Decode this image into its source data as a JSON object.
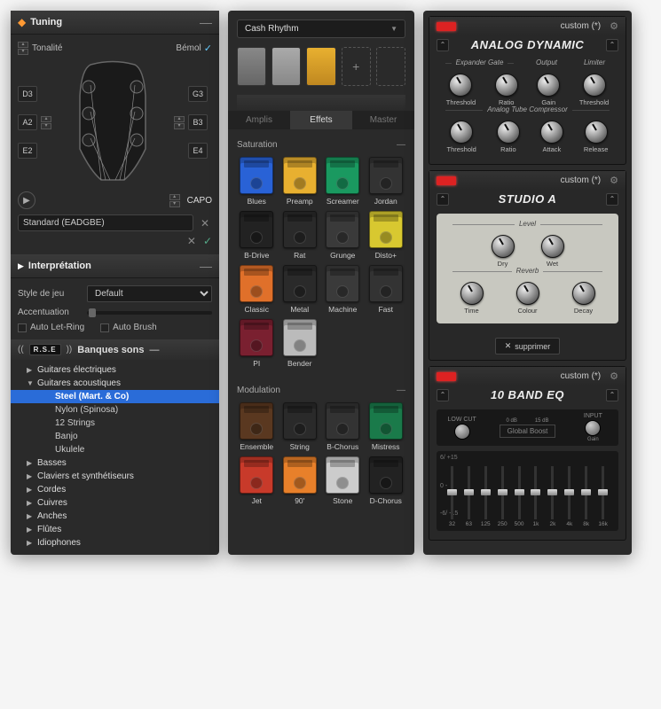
{
  "tuning": {
    "title": "Tuning",
    "tonalite": "Tonalité",
    "bemol": "Bémol",
    "pegs_left": [
      "D3",
      "A2",
      "E2"
    ],
    "pegs_right": [
      "G3",
      "B3",
      "E4"
    ],
    "capo": "CAPO",
    "preset": "Standard (EADGBE)"
  },
  "interp": {
    "title": "Interprétation",
    "style_label": "Style de jeu",
    "style_value": "Default",
    "accent_label": "Accentuation",
    "auto_letring": "Auto Let-Ring",
    "auto_brush": "Auto Brush"
  },
  "banks": {
    "rse": "R.S.E",
    "title": "Banques sons",
    "items": [
      {
        "label": "Guitares électriques",
        "exp": "▶"
      },
      {
        "label": "Guitares acoustiques",
        "exp": "▼"
      },
      {
        "label": "Steel (Mart. & Co)",
        "sel": true,
        "sub": true
      },
      {
        "label": "Nylon (Spinosa)",
        "sub": true
      },
      {
        "label": "12 Strings",
        "sub": true
      },
      {
        "label": "Banjo",
        "sub": true
      },
      {
        "label": "Ukulele",
        "sub": true
      },
      {
        "label": "Basses",
        "exp": "▶"
      },
      {
        "label": "Claviers et synthétiseurs",
        "exp": "▶"
      },
      {
        "label": "Cordes",
        "exp": "▶"
      },
      {
        "label": "Cuivres",
        "exp": "▶"
      },
      {
        "label": "Anches",
        "exp": "▶"
      },
      {
        "label": "Flûtes",
        "exp": "▶"
      },
      {
        "label": "Idiophones",
        "exp": "▶"
      }
    ]
  },
  "fx": {
    "preset": "Cash Rhythm",
    "tabs": [
      "Amplis",
      "Effets",
      "Master"
    ],
    "sections": [
      {
        "title": "Saturation",
        "pedals": [
          {
            "label": "Blues",
            "color": "#2962d6"
          },
          {
            "label": "Preamp",
            "color": "#e8b030"
          },
          {
            "label": "Screamer",
            "color": "#1a9960"
          },
          {
            "label": "Jordan",
            "color": "#333"
          },
          {
            "label": "B-Drive",
            "color": "#222"
          },
          {
            "label": "Rat",
            "color": "#2a2a2a"
          },
          {
            "label": "Grunge",
            "color": "#3a3a3a"
          },
          {
            "label": "Disto+",
            "color": "#d8c830"
          },
          {
            "label": "Classic",
            "color": "#e0702a"
          },
          {
            "label": "Metal",
            "color": "#2a2a2a"
          },
          {
            "label": "Machine",
            "color": "#3a3a3a"
          },
          {
            "label": "Fast",
            "color": "#333"
          },
          {
            "label": "PI",
            "color": "#7a2030"
          },
          {
            "label": "Bender",
            "color": "#bbb"
          }
        ]
      },
      {
        "title": "Modulation",
        "pedals": [
          {
            "label": "Ensemble",
            "color": "#5a3820"
          },
          {
            "label": "String",
            "color": "#2a2a2a"
          },
          {
            "label": "B-Chorus",
            "color": "#333"
          },
          {
            "label": "Mistress",
            "color": "#1a7a4a"
          },
          {
            "label": "Jet",
            "color": "#c83a2a"
          },
          {
            "label": "90'",
            "color": "#e8802a"
          },
          {
            "label": "Stone",
            "color": "#ccc"
          },
          {
            "label": "D-Chorus",
            "color": "#222"
          }
        ]
      }
    ]
  },
  "racks": {
    "custom": "custom (*)",
    "analog": {
      "title": "ANALOG DYNAMIC",
      "groups1": [
        "Expander Gate",
        "Output",
        "Limiter"
      ],
      "knobs1": [
        "Threshold",
        "Ratio",
        "Gain",
        "Threshold"
      ],
      "group2": "Analog Tube Compressor",
      "knobs2": [
        "Threshold",
        "Ratio",
        "Attack",
        "Release"
      ]
    },
    "studio": {
      "title": "STUDIO A",
      "group1": "Level",
      "knobs1": [
        "Dry",
        "Wet"
      ],
      "group2": "Reverb",
      "knobs2": [
        "Time",
        "Colour",
        "Decay"
      ],
      "remove": "supprimer"
    },
    "eq": {
      "title": "10 BAND EQ",
      "lowcut": "LOW CUT",
      "boost": "Global Boost",
      "boost_scale": [
        "0 dB",
        "15 dB"
      ],
      "input": "INPUT",
      "gain": "Gain",
      "scale": [
        "6/ +15",
        "0 -",
        "-6/ -15"
      ],
      "freqs": [
        "32",
        "63",
        "125",
        "250",
        "500",
        "1k",
        "2k",
        "4k",
        "8k",
        "16k"
      ]
    }
  }
}
